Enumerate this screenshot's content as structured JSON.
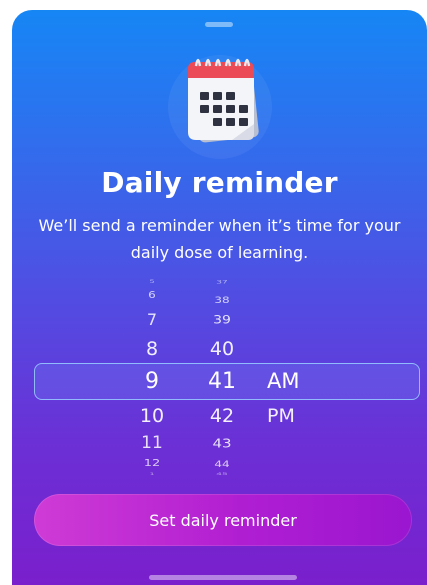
{
  "header": {
    "title": "Daily reminder",
    "subtitle": "We’ll send a reminder when it’s time for your daily dose of learning."
  },
  "icons": {
    "illustration": "calendar-icon"
  },
  "picker": {
    "hours": [
      "5",
      "6",
      "7",
      "8",
      "9",
      "10",
      "11",
      "12",
      "1"
    ],
    "minutes": [
      "37",
      "38",
      "39",
      "40",
      "41",
      "42",
      "43",
      "44",
      "45"
    ],
    "periods": [
      "AM",
      "PM"
    ],
    "selected_hour": "9",
    "selected_minute": "41",
    "selected_period": "AM"
  },
  "actions": {
    "set_label": "Set daily reminder"
  },
  "colors": {
    "gradient_top": "#1686f5",
    "gradient_bottom": "#7a1fcc",
    "button": "#b01ed2",
    "selection_border": "#96c8ff"
  }
}
